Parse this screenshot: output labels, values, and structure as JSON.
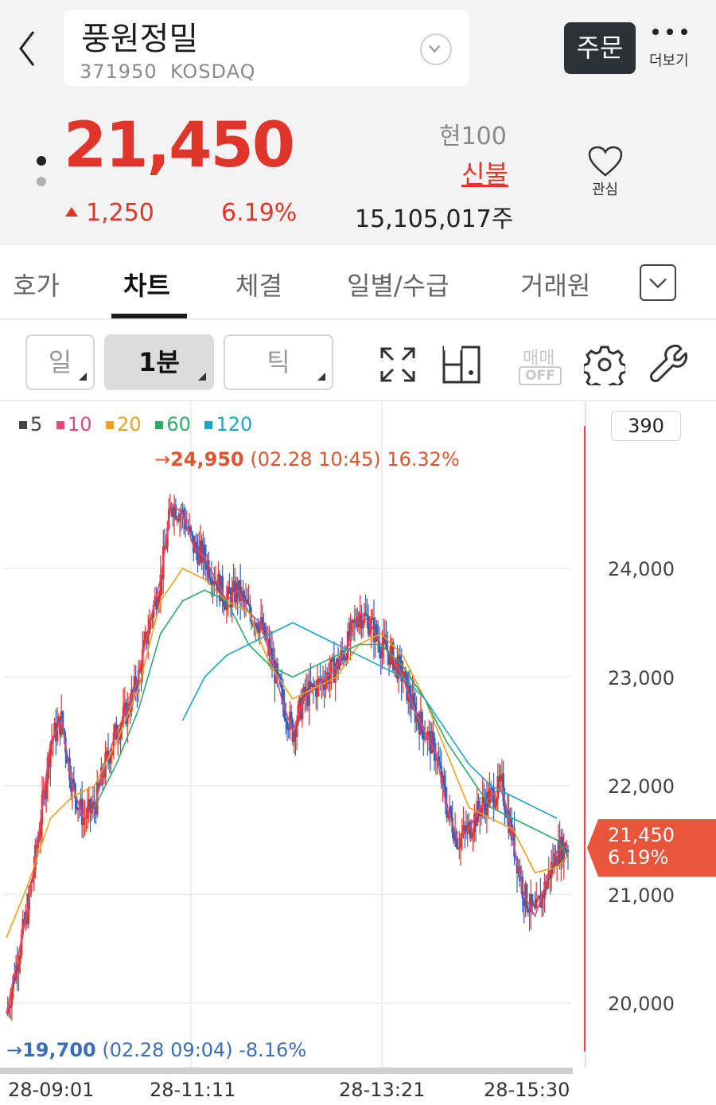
{
  "header": {
    "stock_name": "풍원정밀",
    "stock_code": "371950",
    "market": "KOSDAQ",
    "order_label": "주문",
    "more_label": "더보기"
  },
  "quote": {
    "price": "21,450",
    "change": "1,250",
    "change_pct": "6.19%",
    "unit": "현100",
    "high_label": "신불",
    "volume": "15,105,017주",
    "watch_label": "관심",
    "up_color": "#e0352b"
  },
  "tabs": [
    {
      "label": "호가",
      "active": false
    },
    {
      "label": "차트",
      "active": true
    },
    {
      "label": "체결",
      "active": false
    },
    {
      "label": "일별/수급",
      "active": false
    },
    {
      "label": "거래원",
      "active": false
    }
  ],
  "toolbar": {
    "periods": [
      {
        "label": "일",
        "active": false
      },
      {
        "label": "1분",
        "active": true
      },
      {
        "label": "틱",
        "active": false
      }
    ],
    "trade_top": "매매",
    "trade_bottom": "OFF"
  },
  "chart_data": {
    "type": "candlestick",
    "ma_legend": [
      {
        "name": "5",
        "color": "#444444"
      },
      {
        "name": "10",
        "color": "#e0497a"
      },
      {
        "name": "20",
        "color": "#f0a020"
      },
      {
        "name": "60",
        "color": "#2eaa6a"
      },
      {
        "name": "120",
        "color": "#1aa6c8"
      }
    ],
    "volume_box": "390",
    "max_annotation": {
      "price": "24,950",
      "detail": "(02.28 10:45) 16.32%"
    },
    "min_annotation": {
      "price": "19,700",
      "detail": "(02.28 09:04) -8.16%"
    },
    "y_ticks": [
      "24,000",
      "23,000",
      "22,000",
      "21,000",
      "20,000"
    ],
    "y_tick_values": [
      24000,
      23000,
      22000,
      21000,
      20000
    ],
    "x_ticks": [
      "28-09:01",
      "28-11:11",
      "28-13:21",
      "28-15:30"
    ],
    "current_price_tag": {
      "price": "21,450",
      "pct": "6.19%",
      "value": 21450
    },
    "ylim": [
      19700,
      25300
    ],
    "price_path": [
      [
        0,
        19900
      ],
      [
        1,
        20400
      ],
      [
        2,
        20900
      ],
      [
        3,
        21600
      ],
      [
        4,
        22400
      ],
      [
        5,
        22600
      ],
      [
        6,
        22000
      ],
      [
        7,
        21700
      ],
      [
        8,
        21800
      ],
      [
        9,
        22200
      ],
      [
        10,
        22500
      ],
      [
        11,
        22700
      ],
      [
        12,
        23000
      ],
      [
        13,
        23500
      ],
      [
        14,
        23900
      ],
      [
        15,
        24600
      ],
      [
        16,
        24500
      ],
      [
        17,
        24200
      ],
      [
        18,
        24100
      ],
      [
        19,
        23900
      ],
      [
        20,
        23700
      ],
      [
        21,
        23800
      ],
      [
        22,
        23600
      ],
      [
        23,
        23500
      ],
      [
        24,
        23200
      ],
      [
        25,
        22800
      ],
      [
        26,
        22500
      ],
      [
        27,
        22800
      ],
      [
        28,
        22900
      ],
      [
        29,
        23000
      ],
      [
        30,
        23100
      ],
      [
        31,
        23300
      ],
      [
        32,
        23600
      ],
      [
        33,
        23500
      ],
      [
        34,
        23300
      ],
      [
        35,
        23200
      ],
      [
        36,
        23000
      ],
      [
        37,
        22700
      ],
      [
        38,
        22500
      ],
      [
        39,
        22300
      ],
      [
        40,
        21800
      ],
      [
        41,
        21500
      ],
      [
        42,
        21600
      ],
      [
        43,
        21800
      ],
      [
        44,
        21900
      ],
      [
        45,
        22000
      ],
      [
        46,
        21500
      ],
      [
        47,
        21000
      ],
      [
        48,
        20800
      ],
      [
        49,
        21100
      ],
      [
        50,
        21400
      ],
      [
        51,
        21450
      ]
    ],
    "ma20_path": [
      [
        0,
        20600
      ],
      [
        2,
        21100
      ],
      [
        4,
        21700
      ],
      [
        6,
        21900
      ],
      [
        8,
        22000
      ],
      [
        10,
        22400
      ],
      [
        12,
        22900
      ],
      [
        14,
        23700
      ],
      [
        16,
        24000
      ],
      [
        18,
        23900
      ],
      [
        20,
        23700
      ],
      [
        22,
        23600
      ],
      [
        24,
        23100
      ],
      [
        26,
        22800
      ],
      [
        28,
        22900
      ],
      [
        30,
        23000
      ],
      [
        32,
        23300
      ],
      [
        34,
        23400
      ],
      [
        36,
        23200
      ],
      [
        38,
        22800
      ],
      [
        40,
        22300
      ],
      [
        42,
        21800
      ],
      [
        44,
        21700
      ],
      [
        46,
        21600
      ],
      [
        48,
        21200
      ],
      [
        50,
        21250
      ],
      [
        51,
        21350
      ]
    ],
    "ma60_path": [
      [
        8,
        21800
      ],
      [
        10,
        22200
      ],
      [
        12,
        22700
      ],
      [
        14,
        23400
      ],
      [
        16,
        23700
      ],
      [
        18,
        23800
      ],
      [
        20,
        23700
      ],
      [
        22,
        23300
      ],
      [
        24,
        23100
      ],
      [
        26,
        23000
      ],
      [
        28,
        23100
      ],
      [
        30,
        23200
      ],
      [
        32,
        23300
      ],
      [
        34,
        23300
      ],
      [
        36,
        23100
      ],
      [
        38,
        22800
      ],
      [
        40,
        22400
      ],
      [
        42,
        22100
      ],
      [
        44,
        21800
      ],
      [
        46,
        21700
      ],
      [
        48,
        21600
      ],
      [
        50,
        21500
      ],
      [
        51,
        21350
      ]
    ],
    "ma120_path": [
      [
        16,
        22600
      ],
      [
        18,
        23000
      ],
      [
        20,
        23200
      ],
      [
        22,
        23300
      ],
      [
        24,
        23400
      ],
      [
        26,
        23500
      ],
      [
        28,
        23400
      ],
      [
        30,
        23300
      ],
      [
        32,
        23200
      ],
      [
        34,
        23100
      ],
      [
        36,
        23000
      ],
      [
        38,
        22800
      ],
      [
        40,
        22500
      ],
      [
        42,
        22200
      ],
      [
        44,
        22000
      ],
      [
        46,
        21900
      ],
      [
        48,
        21800
      ],
      [
        50,
        21700
      ]
    ]
  }
}
